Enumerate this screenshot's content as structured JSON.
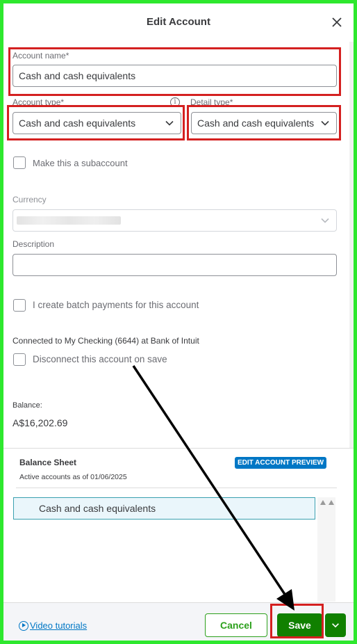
{
  "dialog": {
    "title": "Edit Account"
  },
  "form": {
    "account_name_label": "Account name*",
    "account_name_value": "Cash and cash equivalents",
    "account_type_label": "Account type*",
    "account_type_value": "Cash and cash equivalents",
    "detail_type_label": "Detail type*",
    "detail_type_value": "Cash and cash equivalents",
    "subaccount_label": "Make this a subaccount",
    "currency_label": "Currency",
    "description_label": "Description",
    "description_value": "",
    "batch_payments_label": "I create batch payments for this account",
    "connected_text": "Connected to My Checking (6644) at Bank of Intuit",
    "disconnect_label": "Disconnect this account on save",
    "balance_label": "Balance:",
    "balance_value": "A$16,202.69"
  },
  "preview": {
    "title": "Balance Sheet",
    "subtitle": "Active accounts as of 01/06/2025",
    "edit_badge": "EDIT ACCOUNT PREVIEW",
    "account_row": "Cash and cash equivalents"
  },
  "footer": {
    "video_label": "Video tutorials",
    "cancel_label": "Cancel",
    "save_label": "Save"
  },
  "colors": {
    "highlight_border": "#2ee82e",
    "annotation_red": "#d42020",
    "primary_green": "#108000",
    "link_blue": "#0077c5"
  },
  "icons": {
    "close": "close-icon",
    "info": "info-icon",
    "chevron": "chevron-down-icon",
    "play": "play-circle-icon"
  }
}
